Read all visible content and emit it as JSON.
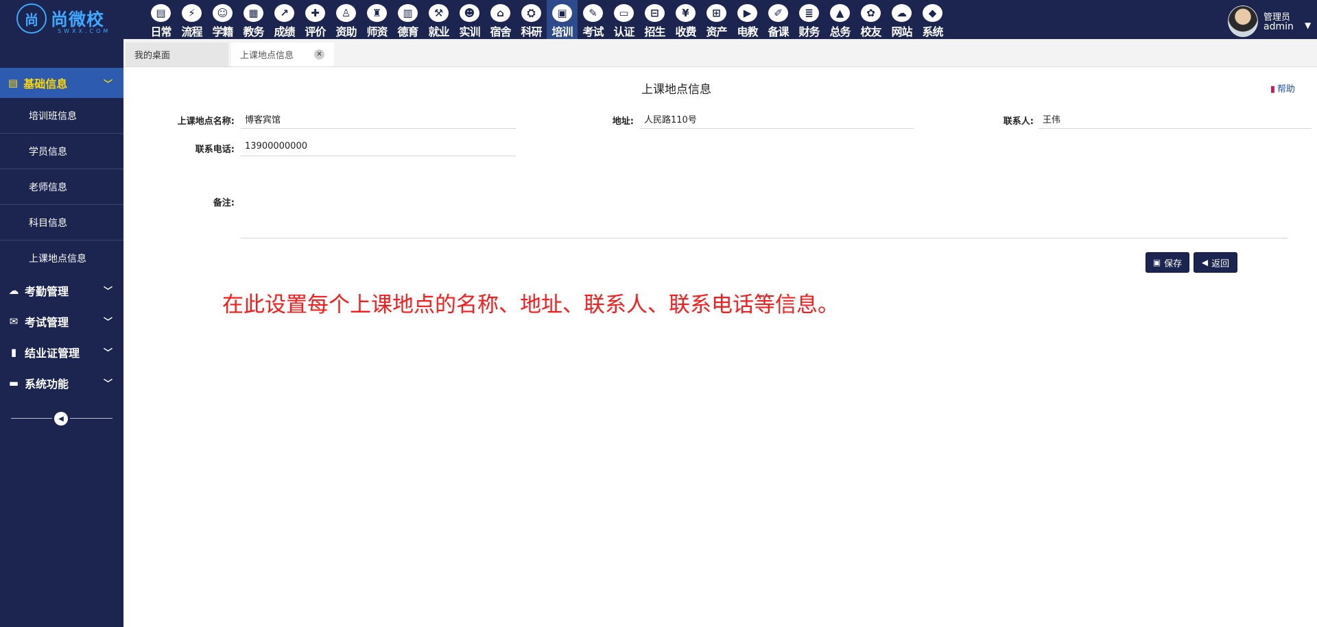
{
  "logo": {
    "mark": "尚",
    "name": "尚微校",
    "sub": "SWXX.COM"
  },
  "modules": [
    {
      "label": "日常",
      "icon": "▤"
    },
    {
      "label": "流程",
      "icon": "⚡"
    },
    {
      "label": "学籍",
      "icon": "☺"
    },
    {
      "label": "教务",
      "icon": "▦"
    },
    {
      "label": "成绩",
      "icon": "↗"
    },
    {
      "label": "评价",
      "icon": "✚"
    },
    {
      "label": "资助",
      "icon": "♙"
    },
    {
      "label": "师资",
      "icon": "♜"
    },
    {
      "label": "德育",
      "icon": "▥"
    },
    {
      "label": "就业",
      "icon": "⚒"
    },
    {
      "label": "实训",
      "icon": "☻"
    },
    {
      "label": "宿舍",
      "icon": "⌂"
    },
    {
      "label": "科研",
      "icon": "⛭"
    },
    {
      "label": "培训",
      "icon": "▣"
    },
    {
      "label": "考试",
      "icon": "✎"
    },
    {
      "label": "认证",
      "icon": "▭"
    },
    {
      "label": "招生",
      "icon": "⊟"
    },
    {
      "label": "收费",
      "icon": "¥"
    },
    {
      "label": "资产",
      "icon": "⊞"
    },
    {
      "label": "电教",
      "icon": "▶"
    },
    {
      "label": "备课",
      "icon": "✐"
    },
    {
      "label": "财务",
      "icon": "≣"
    },
    {
      "label": "总务",
      "icon": "▲"
    },
    {
      "label": "校友",
      "icon": "✿"
    },
    {
      "label": "网站",
      "icon": "☁"
    },
    {
      "label": "系统",
      "icon": "◆"
    }
  ],
  "active_module": "培训",
  "user": {
    "role": "管理员",
    "name": "admin"
  },
  "sidebar": {
    "section": {
      "label": "基础信息",
      "icon": "book-icon"
    },
    "items": [
      {
        "label": "培训班信息"
      },
      {
        "label": "学员信息"
      },
      {
        "label": "老师信息"
      },
      {
        "label": "科目信息"
      },
      {
        "label": "上课地点信息"
      }
    ],
    "groups": [
      {
        "label": "考勤管理",
        "icon": "cloud-icon",
        "glyph": "☁"
      },
      {
        "label": "考试管理",
        "icon": "envelope-icon",
        "glyph": "✉"
      },
      {
        "label": "结业证管理",
        "icon": "file-icon",
        "glyph": "▮"
      },
      {
        "label": "系统功能",
        "icon": "folder-icon",
        "glyph": "▬"
      }
    ]
  },
  "tabs": [
    {
      "label": "我的桌面"
    },
    {
      "label": "上课地点信息"
    }
  ],
  "form": {
    "title": "上课地点信息",
    "help_label": "帮助",
    "name_label": "上课地点名称:",
    "name_value": "博客宾馆",
    "address_label": "地址:",
    "address_value": "人民路110号",
    "contact_label": "联系人:",
    "contact_value": "王伟",
    "phone_label": "联系电话:",
    "phone_value": "13900000000",
    "remark_label": "备注:",
    "remark_value": "",
    "save_label": "保存",
    "back_label": "返回"
  },
  "note": "在此设置每个上课地点的名称、地址、联系人、联系电话等信息。",
  "colors": {
    "nav_bg": "#1b2550",
    "sidebar_active": "#2d5bb0",
    "active_text": "#ffd700",
    "note_red": "#ff1a1a"
  }
}
